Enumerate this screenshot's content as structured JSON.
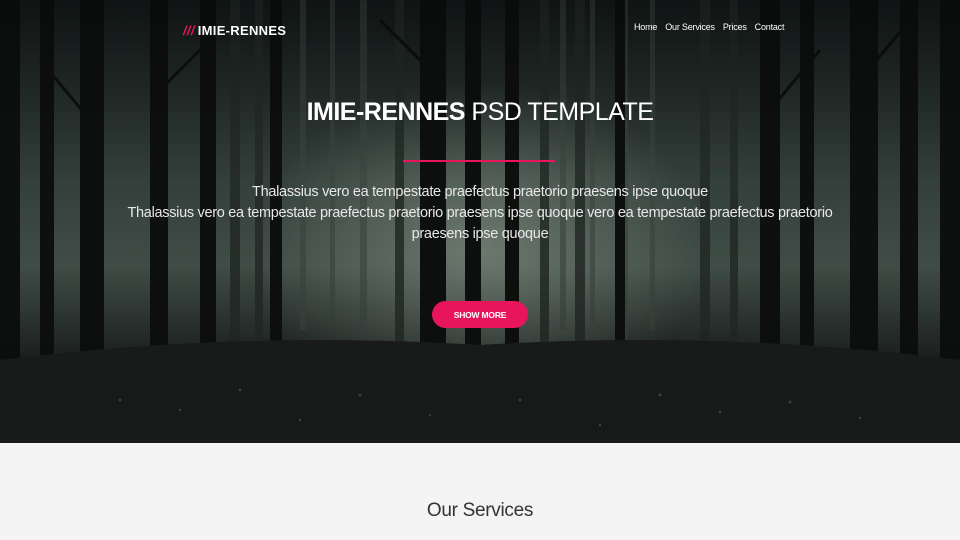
{
  "header": {
    "logo_mark": "///",
    "logo_text": "IMIE-RENNES",
    "nav": [
      {
        "label": "Home"
      },
      {
        "label": "Our Services"
      },
      {
        "label": "Prices"
      },
      {
        "label": "Contact"
      }
    ]
  },
  "hero": {
    "title_strong": "IMIE-RENNES",
    "title_light": "PSD TEMPLATE",
    "line1": "Thalassius vero ea tempestate praefectus praetorio praesens ipse quoque",
    "line2": "Thalassius vero ea tempestate praefectus praetorio praesens ipse quoque vero ea tempestate praefectus praetorio praesens ipse quoque",
    "button_label": "SHOW MORE"
  },
  "services": {
    "title": "Our Services"
  },
  "colors": {
    "accent": "#e8155c",
    "section_bg": "#f4f4f4"
  }
}
